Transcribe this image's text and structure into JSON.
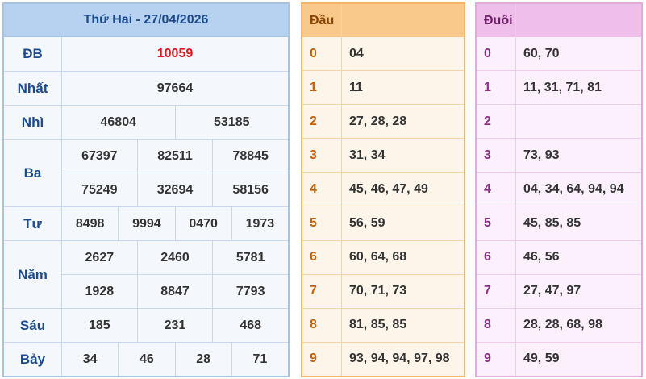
{
  "results": {
    "title": "Thứ Hai - 27/04/2026",
    "rows": [
      {
        "label": "ĐB",
        "lines": [
          [
            "10059"
          ]
        ]
      },
      {
        "label": "Nhất",
        "lines": [
          [
            "97664"
          ]
        ]
      },
      {
        "label": "Nhì",
        "lines": [
          [
            "46804",
            "53185"
          ]
        ]
      },
      {
        "label": "Ba",
        "lines": [
          [
            "67397",
            "82511",
            "78845"
          ],
          [
            "75249",
            "32694",
            "58156"
          ]
        ]
      },
      {
        "label": "Tư",
        "lines": [
          [
            "8498",
            "9994",
            "0470",
            "1973"
          ]
        ]
      },
      {
        "label": "Năm",
        "lines": [
          [
            "2627",
            "2460",
            "5781"
          ],
          [
            "1928",
            "8847",
            "7793"
          ]
        ]
      },
      {
        "label": "Sáu",
        "lines": [
          [
            "185",
            "231",
            "468"
          ]
        ]
      },
      {
        "label": "Bảy",
        "lines": [
          [
            "34",
            "46",
            "28",
            "71"
          ]
        ]
      }
    ],
    "special_color": "#e8111b"
  },
  "dau": {
    "header": "Đầu",
    "rows": [
      {
        "key": "0",
        "values": "04"
      },
      {
        "key": "1",
        "values": "11"
      },
      {
        "key": "2",
        "values": "27, 28, 28"
      },
      {
        "key": "3",
        "values": "31, 34"
      },
      {
        "key": "4",
        "values": "45, 46, 47, 49"
      },
      {
        "key": "5",
        "values": "56, 59"
      },
      {
        "key": "6",
        "values": "60, 64, 68"
      },
      {
        "key": "7",
        "values": "70, 71, 73"
      },
      {
        "key": "8",
        "values": "81, 85, 85"
      },
      {
        "key": "9",
        "values": "93, 94, 94, 97, 98"
      }
    ]
  },
  "duoi": {
    "header": "Đuôi",
    "rows": [
      {
        "key": "0",
        "values": "60, 70"
      },
      {
        "key": "1",
        "values": "11, 31, 71, 81"
      },
      {
        "key": "2",
        "values": ""
      },
      {
        "key": "3",
        "values": "73, 93"
      },
      {
        "key": "4",
        "values": "04, 34, 64, 94, 94"
      },
      {
        "key": "5",
        "values": "45, 85, 85"
      },
      {
        "key": "6",
        "values": "46, 56"
      },
      {
        "key": "7",
        "values": "27, 47, 97"
      },
      {
        "key": "8",
        "values": "28, 28, 68, 98"
      },
      {
        "key": "9",
        "values": "49, 59"
      }
    ]
  }
}
